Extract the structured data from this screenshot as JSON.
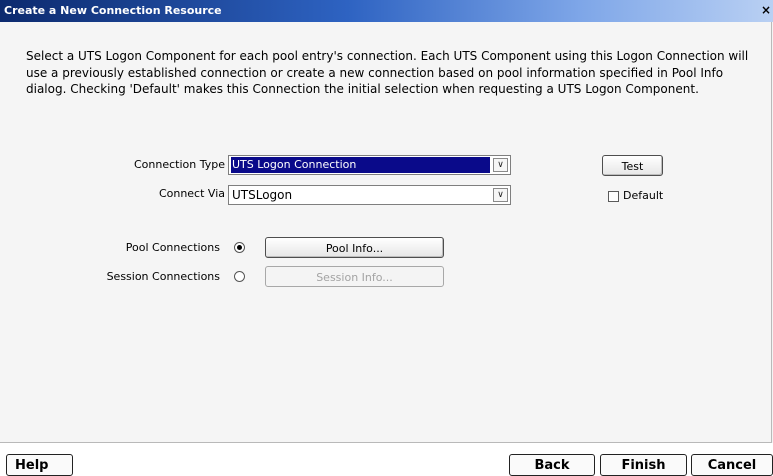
{
  "dialog": {
    "title": "Create a New Connection Resource",
    "close_glyph": "×",
    "instructions": "Select a UTS Logon Component for each pool entry's connection. Each UTS Component using this Logon Connection will use a previously established connection or create a new connection based on pool information specified in Pool Info dialog. Checking 'Default' makes this Connection the initial selection when requesting a UTS Logon Component."
  },
  "form": {
    "connection_type": {
      "label": "Connection Type",
      "value": "UTS Logon Connection"
    },
    "connect_via": {
      "label": "Connect Via",
      "value": "UTSLogon"
    },
    "test_button": "Test",
    "default_checkbox": {
      "label": "Default",
      "checked": false
    },
    "pool_connections": {
      "label": "Pool Connections",
      "selected": true,
      "button": "Pool Info..."
    },
    "session_connections": {
      "label": "Session Connections",
      "selected": false,
      "button": "Session Info...",
      "button_enabled": false
    }
  },
  "footer": {
    "help": "Help",
    "back": "Back",
    "finish": "Finish",
    "cancel": "Cancel"
  },
  "icons": {
    "dropdown": "chevron-down-icon",
    "close": "close-icon"
  }
}
